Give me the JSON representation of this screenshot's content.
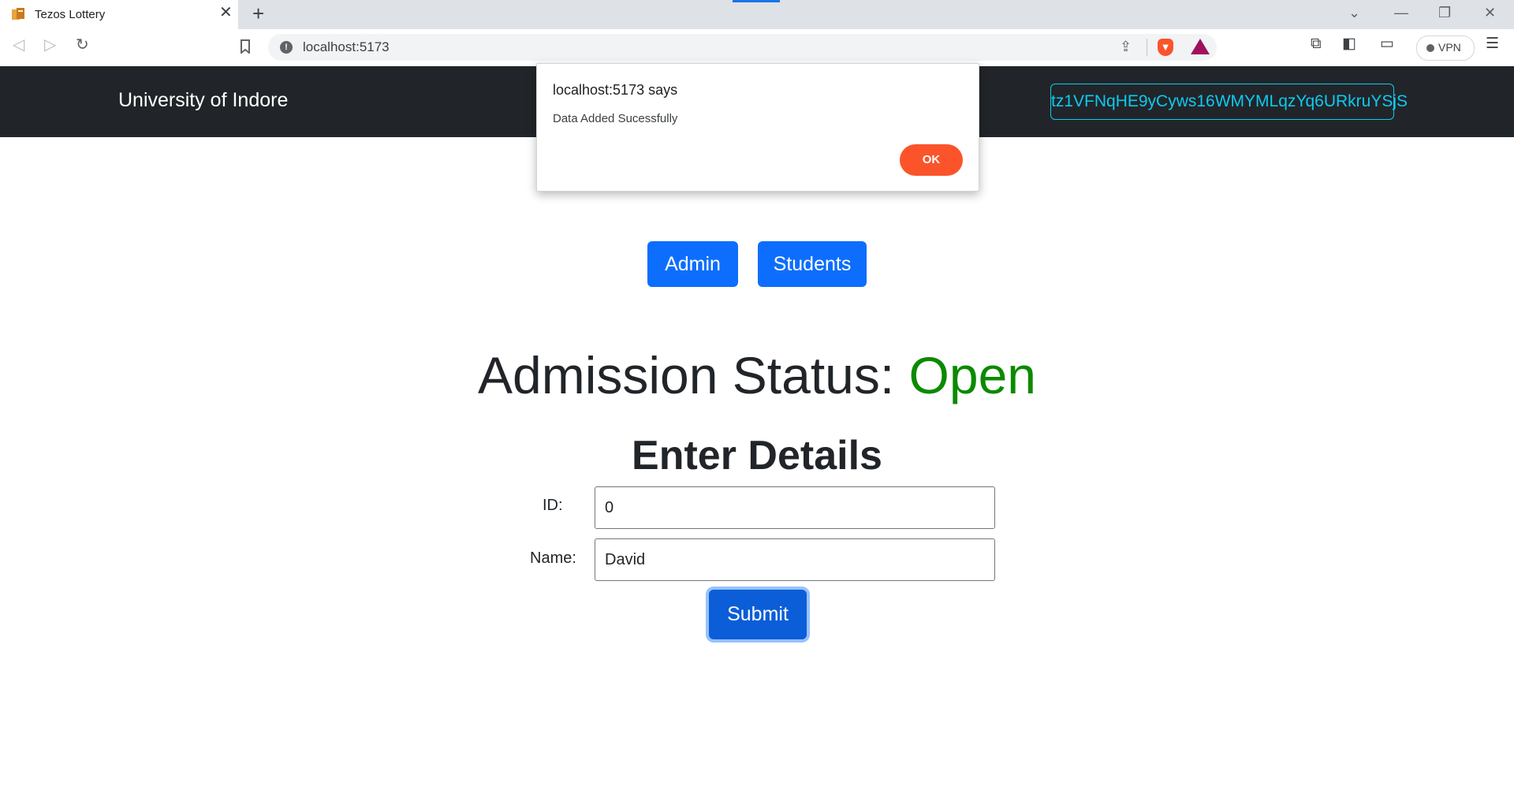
{
  "browser": {
    "tab_title": "Tezos Lottery",
    "tab_close": "✕",
    "new_tab": "+",
    "url": "localhost:5173",
    "vpn_label": "VPN",
    "icons": [
      "back-icon",
      "forward-icon",
      "reload-icon",
      "bookmark-icon",
      "site-info-icon",
      "share-icon",
      "brave-shields-icon",
      "brave-rewards-icon",
      "extensions-icon",
      "sidebar-icon",
      "wallet-icon",
      "menu-icon"
    ]
  },
  "navbar": {
    "brand": "University of Indore",
    "wallet_address": "tz1VFNqHE9yCyws16WMYMLqzYq6URkruYSjS"
  },
  "buttons": {
    "admin": "Admin",
    "students": "Students"
  },
  "status": {
    "label": "Admission Status: ",
    "value": "Open",
    "value_color": "#0b8a00"
  },
  "form": {
    "heading": "Enter Details",
    "id_label": "ID:",
    "id_value": "0",
    "name_label": "Name:",
    "name_value": "David",
    "submit": "Submit"
  },
  "dialog": {
    "title": "localhost:5173 says",
    "message": "Data Added Sucessfully",
    "ok": "OK",
    "accent": "#fb542b"
  }
}
